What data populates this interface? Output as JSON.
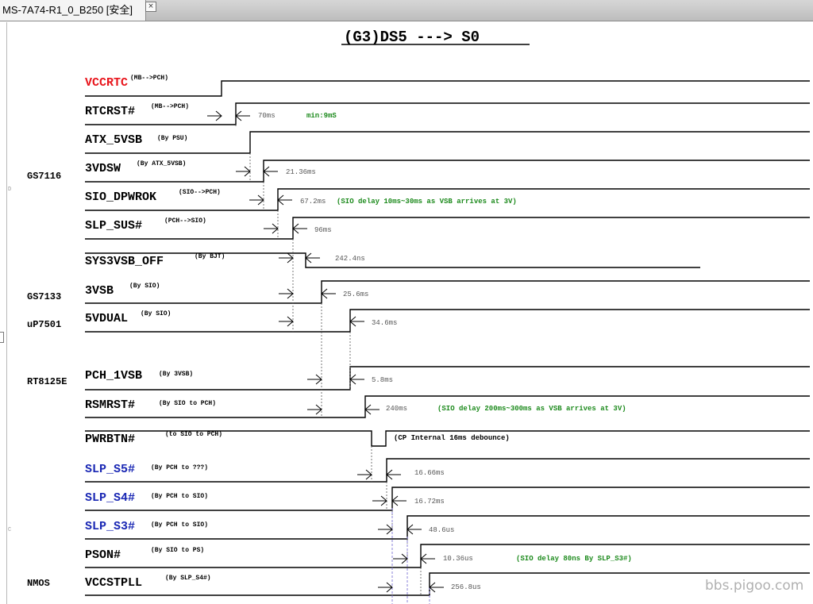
{
  "window": {
    "tab_title": "MS-7A74-R1_0_B250 [安全]",
    "close_glyph": "×"
  },
  "diagram": {
    "title": "(G3)DS5  ---> S0",
    "colors": {
      "line": "#000000",
      "text": "#000000",
      "red": "#e8141b",
      "blue": "#1a28b4",
      "green": "#1c8a1c",
      "gray": "#555555",
      "violet": "#8a80d8"
    },
    "chips": [
      "GS7116",
      "GS7133",
      "uP7501",
      "RT8125E",
      "NMOS"
    ],
    "signals": [
      {
        "name": "VCCRTC",
        "note": "(MB-->PCH)",
        "color": "red"
      },
      {
        "name": "RTCRST#",
        "note": "(MB-->PCH)",
        "color": "black"
      },
      {
        "name": "ATX_5VSB",
        "note": "(By PSU)",
        "color": "black"
      },
      {
        "name": "3VDSW",
        "note": "(By ATX_5VSB)",
        "color": "black"
      },
      {
        "name": "SIO_DPWROK",
        "note": "(SIO-->PCH)",
        "color": "black"
      },
      {
        "name": "SLP_SUS#",
        "note": "(PCH-->SIO)",
        "color": "black"
      },
      {
        "name": "SYS3VSB_OFF",
        "note": "(By BJT)",
        "color": "black"
      },
      {
        "name": "3VSB",
        "note": "(By SIO)",
        "color": "black"
      },
      {
        "name": "5VDUAL",
        "note": "(By SIO)",
        "color": "black"
      },
      {
        "name": "PCH_1VSB",
        "note": "(By 3VSB)",
        "color": "black"
      },
      {
        "name": "RSMRST#",
        "note": "(By SIO to PCH)",
        "color": "black"
      },
      {
        "name": "PWRBTN#",
        "note": "(to SIO to PCH)",
        "color": "black"
      },
      {
        "name": "SLP_S5#",
        "note": "(By PCH to ???)",
        "color": "blue"
      },
      {
        "name": "SLP_S4#",
        "note": "(By PCH to SIO)",
        "color": "blue"
      },
      {
        "name": "SLP_S3#",
        "note": "(By PCH to SIO)",
        "color": "blue"
      },
      {
        "name": "PSON#",
        "note": "(By SIO to PS)",
        "color": "black"
      },
      {
        "name": "VCCSTPLL",
        "note": "(By SLP_S4#)",
        "color": "black"
      }
    ],
    "timings": [
      "70ms",
      "21.36ms",
      "67.2ms",
      "96ms",
      "242.4ns",
      "25.6ms",
      "34.6ms",
      "5.8ms",
      "240ms",
      "16.66ms",
      "16.72ms",
      "48.6us",
      "10.36us",
      "256.8us"
    ],
    "comments": [
      {
        "text": "min:9mS",
        "color": "green"
      },
      {
        "text": "(SIO delay 10ms~30ms as VSB arrives at 3V)",
        "color": "green"
      },
      {
        "text": "(SIO delay 200ms~300ms as VSB arrives at 3V)",
        "color": "green"
      },
      {
        "text": "(CP Internal 16ms debounce)",
        "color": "black"
      },
      {
        "text": "(SIO delay 80ns By SLP_S3#)",
        "color": "green"
      }
    ],
    "edge_marks": [
      "D",
      "C"
    ]
  },
  "watermark": "bbs.pigoo.com"
}
